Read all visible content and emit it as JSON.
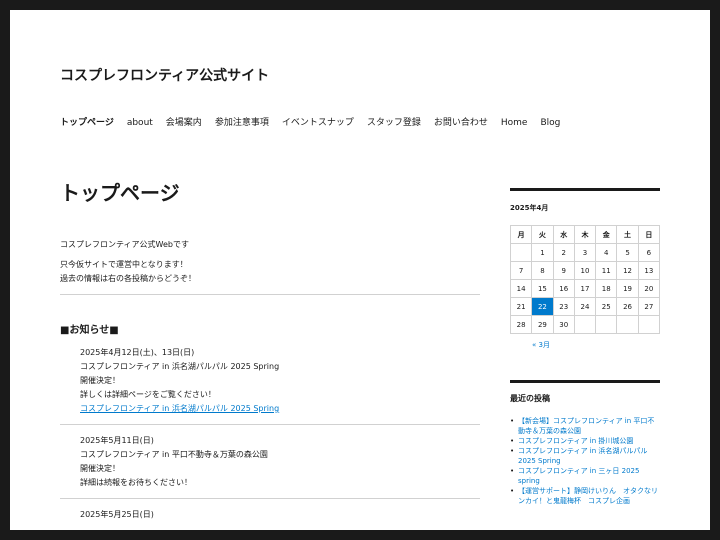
{
  "site": {
    "title": "コスプレフロンティア公式サイト"
  },
  "nav": {
    "items": [
      {
        "label": "トップページ"
      },
      {
        "label": "about"
      },
      {
        "label": "会場案内"
      },
      {
        "label": "参加注意事項"
      },
      {
        "label": "イベントスナップ"
      },
      {
        "label": "スタッフ登録"
      },
      {
        "label": "お問い合わせ"
      },
      {
        "label": "Home"
      },
      {
        "label": "Blog"
      }
    ]
  },
  "main": {
    "title": "トップページ",
    "intro1": "コスプレフロンティア公式Webです",
    "intro2": "只今仮サイトで運営中となります！",
    "intro3": "過去の情報は右の各投稿からどうぞ！",
    "news_heading": "■お知らせ■",
    "news": [
      {
        "line1": "2025年4月12日(土)、13日(日)",
        "line2": "コスプレフロンティア in 浜名湖パルパル 2025 Spring",
        "line3": "開催決定！",
        "line4": "詳しくは詳細ページをご覧ください！",
        "link": "コスプレフロンティア in 浜名湖パルパル 2025 Spring"
      },
      {
        "line1": "2025年5月11日(日)",
        "line2": "コスプレフロンティア in 平口不動寺＆万葉の森公園",
        "line3": "開催決定！",
        "line4": "詳細は続報をお待ちください！"
      },
      {
        "line1": "2025年5月25日(日)"
      }
    ]
  },
  "calendar": {
    "caption": "2025年4月",
    "weekdays": [
      "月",
      "火",
      "水",
      "木",
      "金",
      "土",
      "日"
    ],
    "weeks": [
      [
        "",
        "1",
        "2",
        "3",
        "4",
        "5",
        "6"
      ],
      [
        "7",
        "8",
        "9",
        "10",
        "11",
        "12",
        "13"
      ],
      [
        "14",
        "15",
        "16",
        "17",
        "18",
        "19",
        "20"
      ],
      [
        "21",
        "22",
        "23",
        "24",
        "25",
        "26",
        "27"
      ],
      [
        "28",
        "29",
        "30",
        "",
        "",
        "",
        ""
      ]
    ],
    "today": "22",
    "prev": "« 3月",
    "accent": "#007acc"
  },
  "recent": {
    "title": "最近の投稿",
    "items": [
      {
        "label": "【新会場】コスプレフロンティア in 平口不動寺＆万葉の森公園"
      },
      {
        "label": "コスプレフロンティア in 掛川城公園"
      },
      {
        "label": "コスプレフロンティア in 浜名湖パルパル 2025 Spring"
      },
      {
        "label": "コスプレフロンティア in 三ヶ日 2025 spring"
      },
      {
        "label": "【運営サポート】静岡けいりん　オタクなリンカイ！と鬼龍梅杯　コスプレ企画"
      }
    ]
  }
}
